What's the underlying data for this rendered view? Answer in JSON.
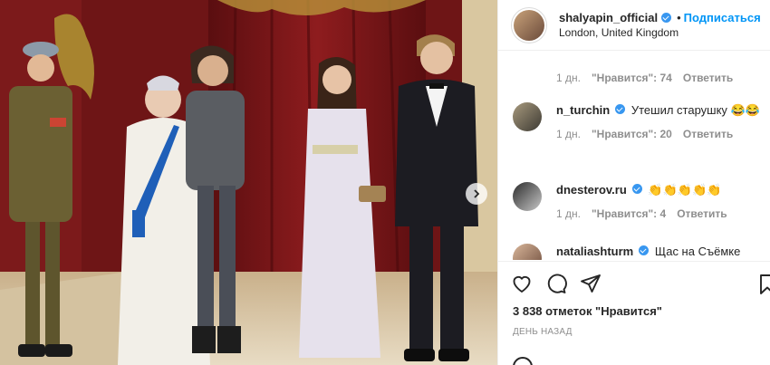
{
  "post": {
    "author": "shalyapin_official",
    "follow_label": "Подписаться",
    "dot": "•",
    "location": "London, United Kingdom"
  },
  "top_meta": {
    "time": "1 дн.",
    "likes": "\"Нравится\": 74",
    "reply": "Ответить"
  },
  "comments": [
    {
      "user": "n_turchin",
      "text": "Утешил старушку 😂😂",
      "time": "1 дн.",
      "likes": "\"Нравится\": 20",
      "reply": "Ответить",
      "verified": true
    },
    {
      "user": "dnesterov.ru",
      "text": "👏👏👏👏👏",
      "time": "1 дн.",
      "likes": "\"Нравится\": 4",
      "reply": "Ответить",
      "verified": true
    },
    {
      "user": "nataliashturm",
      "text": "Щас на Съёмке",
      "verified": true
    }
  ],
  "footer": {
    "likes_count": "3 838 отметок \"Нравится\"",
    "date": "ДЕНЬ НАЗАД"
  },
  "icons": [
    "heart-icon",
    "comment-icon",
    "share-icon",
    "bookmark-icon",
    "carousel-next-icon",
    "verified-icon"
  ],
  "colors": {
    "accent": "#0095f6",
    "verified": "#3897f0",
    "muted": "#8e8e8e"
  }
}
